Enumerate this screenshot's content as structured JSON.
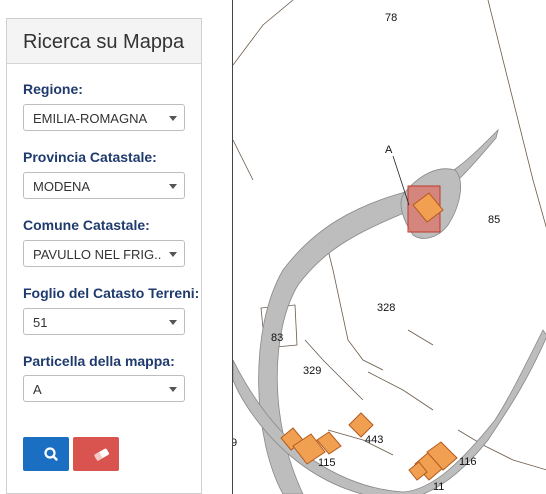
{
  "panel": {
    "title": "Ricerca su Mappa",
    "fields": [
      {
        "label": "Regione:",
        "value": "EMILIA-ROMAGNA"
      },
      {
        "label": "Provincia Catastale:",
        "value": "MODENA"
      },
      {
        "label": "Comune Catastale:",
        "value": "PAVULLO NEL FRIG..."
      },
      {
        "label": "Foglio del Catasto Terreni:",
        "value": "51"
      },
      {
        "label": "Particella della mappa:",
        "value": "A"
      }
    ],
    "buttons": {
      "search_icon": "search-icon",
      "clear_icon": "eraser-icon"
    }
  },
  "map": {
    "parcel_labels": [
      "78",
      "85",
      "328",
      "83",
      "329",
      "443",
      "115",
      "116",
      "A",
      "11",
      "9"
    ],
    "highlight_color": "#e8574a",
    "building_color": "#f0a050",
    "road_color": "#bdbdbd"
  }
}
